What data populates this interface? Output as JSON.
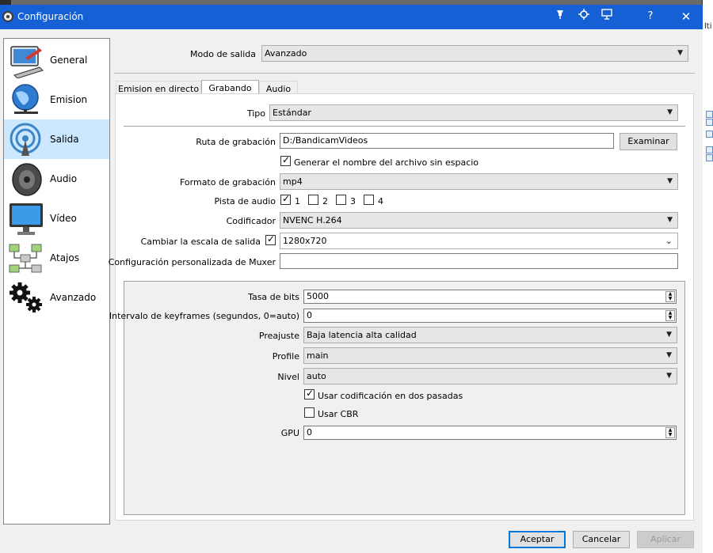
{
  "window": {
    "title": "Configuración",
    "titlebar_icons": [
      "pin-icon",
      "crosshair-icon",
      "screen-icon"
    ],
    "help_label": "?",
    "close_label": "✕"
  },
  "external": {
    "fragment": "lti"
  },
  "sidebar": {
    "items": [
      {
        "label": "General",
        "icon": "computer-icon"
      },
      {
        "label": "Emision",
        "icon": "globe-icon"
      },
      {
        "label": "Salida",
        "icon": "broadcast-icon",
        "active": true
      },
      {
        "label": "Audio",
        "icon": "speaker-icon"
      },
      {
        "label": "Vídeo",
        "icon": "monitor-icon"
      },
      {
        "label": "Atajos",
        "icon": "network-icon"
      },
      {
        "label": "Avanzado",
        "icon": "gears-icon"
      }
    ]
  },
  "output_mode": {
    "label": "Modo de salida",
    "value": "Avanzado"
  },
  "tabs": [
    {
      "label": "Emision en directo"
    },
    {
      "label": "Grabando",
      "active": true
    },
    {
      "label": "Audio"
    }
  ],
  "recording": {
    "type": {
      "label": "Tipo",
      "value": "Estándar"
    },
    "path": {
      "label": "Ruta de grabación",
      "value": "D:/BandicamVideos",
      "browse_label": "Examinar"
    },
    "no_space": {
      "label": "Generar el nombre del archivo sin espacio",
      "checked": true
    },
    "format": {
      "label": "Formato de grabación",
      "value": "mp4"
    },
    "audio_track": {
      "label": "Pista de audio",
      "tracks": [
        {
          "label": "1",
          "checked": true
        },
        {
          "label": "2",
          "checked": false
        },
        {
          "label": "3",
          "checked": false
        },
        {
          "label": "4",
          "checked": false
        }
      ]
    },
    "encoder": {
      "label": "Codificador",
      "value": "NVENC H.264"
    },
    "rescale": {
      "label": "Cambiar la escala de salida",
      "checked": true,
      "value": "1280x720"
    },
    "muxer": {
      "label": "Configuración personalizada de Muxer",
      "value": ""
    }
  },
  "encoder_settings": {
    "bitrate": {
      "label": "Tasa de bits",
      "value": "5000"
    },
    "keyframe": {
      "label": "Intervalo de keyframes (segundos, 0=auto)",
      "value": "0"
    },
    "preset": {
      "label": "Preajuste",
      "value": "Baja latencia alta calidad"
    },
    "profile": {
      "label": "Profile",
      "value": "main"
    },
    "level": {
      "label": "Nivel",
      "value": "auto"
    },
    "two_pass": {
      "label": "Usar codificación en dos pasadas",
      "checked": true
    },
    "cbr": {
      "label": "Usar CBR",
      "checked": false
    },
    "gpu": {
      "label": "GPU",
      "value": "0"
    }
  },
  "footer": {
    "accept": "Aceptar",
    "cancel": "Cancelar",
    "apply": "Aplicar"
  },
  "colors": {
    "titlebar": "#1560d4",
    "selection": "#cce8ff",
    "focus_border": "#0078d7"
  }
}
